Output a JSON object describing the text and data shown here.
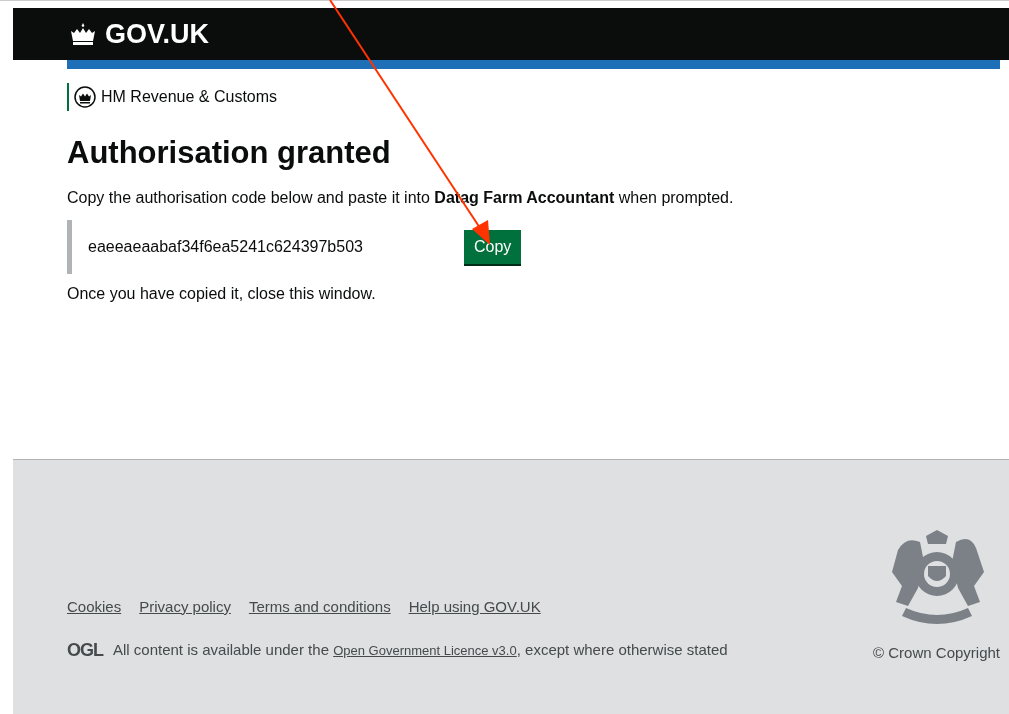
{
  "header": {
    "logo_text": "GOV.UK"
  },
  "service": {
    "name": "HM Revenue & Customs"
  },
  "main": {
    "heading": "Authorisation granted",
    "instruction": "Copy the authorisation code below and paste it into **Datag Farm Accountant** when prompted.",
    "code": "eaeeaeaabaf34f6ea5241c624397b503",
    "copy_button": "Copy",
    "closing": "Once you have copied it, close this window."
  },
  "footer": {
    "links": [
      "Cookies",
      "Privacy policy",
      "Terms and conditions",
      "Help using GOV.UK"
    ],
    "licence_logo": "OGL",
    "licence_before": "All content is available under the ",
    "licence_link": "Open Government Licence v3.0",
    "licence_after": ", except where otherwise stated",
    "copyright": "© Crown Copyright"
  },
  "annotation": {
    "kind": "arrow"
  }
}
